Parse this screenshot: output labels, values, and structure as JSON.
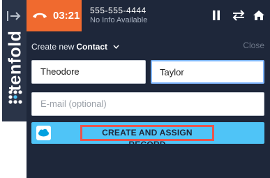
{
  "sidebar": {
    "brand": "tenfold",
    "icons": {
      "collapse": "arrow-right-bar-icon",
      "logo": "tenfold-dots-logo"
    }
  },
  "call": {
    "timer": "03:21",
    "number": "555-555-4444",
    "info": "No Info Available",
    "status_color": "#f06a2f",
    "icons": {
      "hangup": "phone-hangup-icon",
      "pause": "pause-icon",
      "transfer": "transfer-arrows-icon",
      "home": "home-icon"
    }
  },
  "form": {
    "create_label": "Create new",
    "object_type": "Contact",
    "close_label": "Close",
    "first_name": "Theodore",
    "last_name": "Taylor",
    "email_placeholder": "E-mail (optional)",
    "assign_label": "CREATE AND ASSIGN RECORD",
    "assign_icon": "salesforce-cloud-icon"
  },
  "colors": {
    "panel": "#1e273a",
    "sidebar": "#2a3448",
    "accent_orange": "#f06a2f",
    "assign_blue": "#4fc4f7",
    "highlight_red": "#e8554e"
  }
}
